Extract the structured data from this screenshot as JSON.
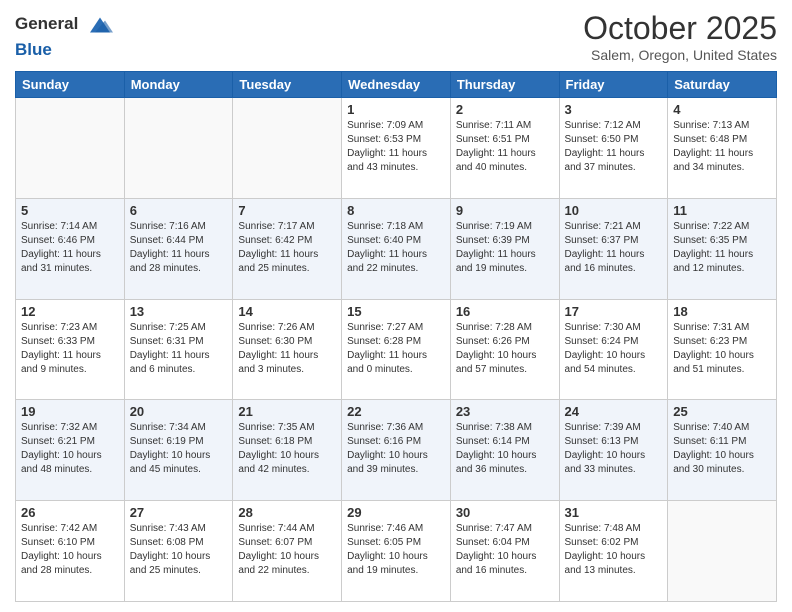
{
  "header": {
    "logo_line1": "General",
    "logo_line2": "Blue",
    "month": "October 2025",
    "location": "Salem, Oregon, United States"
  },
  "weekdays": [
    "Sunday",
    "Monday",
    "Tuesday",
    "Wednesday",
    "Thursday",
    "Friday",
    "Saturday"
  ],
  "weeks": [
    [
      {
        "day": "",
        "info": ""
      },
      {
        "day": "",
        "info": ""
      },
      {
        "day": "",
        "info": ""
      },
      {
        "day": "1",
        "info": "Sunrise: 7:09 AM\nSunset: 6:53 PM\nDaylight: 11 hours\nand 43 minutes."
      },
      {
        "day": "2",
        "info": "Sunrise: 7:11 AM\nSunset: 6:51 PM\nDaylight: 11 hours\nand 40 minutes."
      },
      {
        "day": "3",
        "info": "Sunrise: 7:12 AM\nSunset: 6:50 PM\nDaylight: 11 hours\nand 37 minutes."
      },
      {
        "day": "4",
        "info": "Sunrise: 7:13 AM\nSunset: 6:48 PM\nDaylight: 11 hours\nand 34 minutes."
      }
    ],
    [
      {
        "day": "5",
        "info": "Sunrise: 7:14 AM\nSunset: 6:46 PM\nDaylight: 11 hours\nand 31 minutes."
      },
      {
        "day": "6",
        "info": "Sunrise: 7:16 AM\nSunset: 6:44 PM\nDaylight: 11 hours\nand 28 minutes."
      },
      {
        "day": "7",
        "info": "Sunrise: 7:17 AM\nSunset: 6:42 PM\nDaylight: 11 hours\nand 25 minutes."
      },
      {
        "day": "8",
        "info": "Sunrise: 7:18 AM\nSunset: 6:40 PM\nDaylight: 11 hours\nand 22 minutes."
      },
      {
        "day": "9",
        "info": "Sunrise: 7:19 AM\nSunset: 6:39 PM\nDaylight: 11 hours\nand 19 minutes."
      },
      {
        "day": "10",
        "info": "Sunrise: 7:21 AM\nSunset: 6:37 PM\nDaylight: 11 hours\nand 16 minutes."
      },
      {
        "day": "11",
        "info": "Sunrise: 7:22 AM\nSunset: 6:35 PM\nDaylight: 11 hours\nand 12 minutes."
      }
    ],
    [
      {
        "day": "12",
        "info": "Sunrise: 7:23 AM\nSunset: 6:33 PM\nDaylight: 11 hours\nand 9 minutes."
      },
      {
        "day": "13",
        "info": "Sunrise: 7:25 AM\nSunset: 6:31 PM\nDaylight: 11 hours\nand 6 minutes."
      },
      {
        "day": "14",
        "info": "Sunrise: 7:26 AM\nSunset: 6:30 PM\nDaylight: 11 hours\nand 3 minutes."
      },
      {
        "day": "15",
        "info": "Sunrise: 7:27 AM\nSunset: 6:28 PM\nDaylight: 11 hours\nand 0 minutes."
      },
      {
        "day": "16",
        "info": "Sunrise: 7:28 AM\nSunset: 6:26 PM\nDaylight: 10 hours\nand 57 minutes."
      },
      {
        "day": "17",
        "info": "Sunrise: 7:30 AM\nSunset: 6:24 PM\nDaylight: 10 hours\nand 54 minutes."
      },
      {
        "day": "18",
        "info": "Sunrise: 7:31 AM\nSunset: 6:23 PM\nDaylight: 10 hours\nand 51 minutes."
      }
    ],
    [
      {
        "day": "19",
        "info": "Sunrise: 7:32 AM\nSunset: 6:21 PM\nDaylight: 10 hours\nand 48 minutes."
      },
      {
        "day": "20",
        "info": "Sunrise: 7:34 AM\nSunset: 6:19 PM\nDaylight: 10 hours\nand 45 minutes."
      },
      {
        "day": "21",
        "info": "Sunrise: 7:35 AM\nSunset: 6:18 PM\nDaylight: 10 hours\nand 42 minutes."
      },
      {
        "day": "22",
        "info": "Sunrise: 7:36 AM\nSunset: 6:16 PM\nDaylight: 10 hours\nand 39 minutes."
      },
      {
        "day": "23",
        "info": "Sunrise: 7:38 AM\nSunset: 6:14 PM\nDaylight: 10 hours\nand 36 minutes."
      },
      {
        "day": "24",
        "info": "Sunrise: 7:39 AM\nSunset: 6:13 PM\nDaylight: 10 hours\nand 33 minutes."
      },
      {
        "day": "25",
        "info": "Sunrise: 7:40 AM\nSunset: 6:11 PM\nDaylight: 10 hours\nand 30 minutes."
      }
    ],
    [
      {
        "day": "26",
        "info": "Sunrise: 7:42 AM\nSunset: 6:10 PM\nDaylight: 10 hours\nand 28 minutes."
      },
      {
        "day": "27",
        "info": "Sunrise: 7:43 AM\nSunset: 6:08 PM\nDaylight: 10 hours\nand 25 minutes."
      },
      {
        "day": "28",
        "info": "Sunrise: 7:44 AM\nSunset: 6:07 PM\nDaylight: 10 hours\nand 22 minutes."
      },
      {
        "day": "29",
        "info": "Sunrise: 7:46 AM\nSunset: 6:05 PM\nDaylight: 10 hours\nand 19 minutes."
      },
      {
        "day": "30",
        "info": "Sunrise: 7:47 AM\nSunset: 6:04 PM\nDaylight: 10 hours\nand 16 minutes."
      },
      {
        "day": "31",
        "info": "Sunrise: 7:48 AM\nSunset: 6:02 PM\nDaylight: 10 hours\nand 13 minutes."
      },
      {
        "day": "",
        "info": ""
      }
    ]
  ]
}
